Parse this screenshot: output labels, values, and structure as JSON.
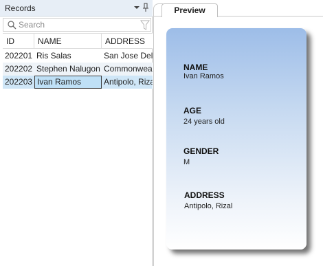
{
  "records_panel": {
    "title": "Records",
    "search_placeholder": "Search",
    "columns": [
      "ID",
      "NAME",
      "ADDRESS"
    ],
    "rows": [
      {
        "id": "202201",
        "name": "Ris Salas",
        "address": "San Jose Del"
      },
      {
        "id": "202202",
        "name": "Stephen Nalugon",
        "address": "Commonwea"
      },
      {
        "id": "202203",
        "name": "Ivan Ramos",
        "address": "Antipolo, Riza"
      }
    ],
    "selected_row": 2
  },
  "preview": {
    "tab_label": "Preview",
    "fields": [
      {
        "label": "NAME",
        "value": "Ivan Ramos"
      },
      {
        "label": "AGE",
        "value": "24 years old"
      },
      {
        "label": "GENDER",
        "value": "M"
      },
      {
        "label": "ADDRESS",
        "value": "Antipolo, Rizal"
      }
    ]
  },
  "icons": [
    "menu-dropdown-icon",
    "pin-icon",
    "search-icon",
    "filter-icon"
  ],
  "colors": {
    "panel_header": "#e7eef6",
    "selected_row": "#cfe6f7",
    "card_top": "#9dbde8",
    "card_bottom": "#ffffff"
  }
}
